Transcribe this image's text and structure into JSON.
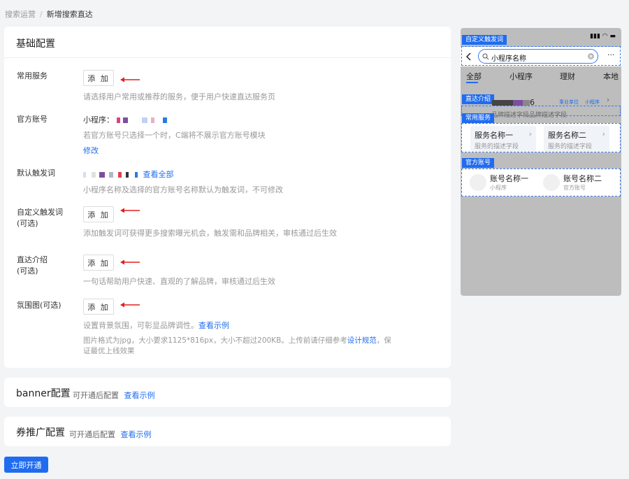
{
  "breadcrumb": {
    "parent": "搜索运营",
    "separator": "/",
    "current": "新增搜索直达"
  },
  "basic": {
    "title": "基础配置",
    "common_service": {
      "label": "常用服务",
      "button": "添 加",
      "hint": "请选择用户常用或推荐的服务，便于用户快速直达服务页"
    },
    "official_account": {
      "label": "官方账号",
      "value_prefix": "小程序：",
      "hint": "若官方账号只选择一个时，C端将不展示官方账号模块",
      "modify": "修改"
    },
    "default_trigger": {
      "label": "默认触发词",
      "view_all": "查看全部",
      "hint": "小程序名称及选择的官方账号名称默认为触发词，不可修改"
    },
    "custom_trigger": {
      "label": "自定义触发词",
      "label2": "(可选)",
      "button": "添 加",
      "hint": "添加触发词可获得更多搜索曝光机会，触发需和品牌相关，审核通过后生效"
    },
    "intro": {
      "label": "直达介绍",
      "label2": "(可选)",
      "button": "添 加",
      "hint": "一句话帮助用户快速、直观的了解品牌，审核通过后生效"
    },
    "atmosphere": {
      "label": "氛围图(可选)",
      "button": "添 加",
      "hint": "设置背景氛围，可彰显品牌调性。",
      "example": "查看示例",
      "req_line1_a": "图片格式为jpg，大小要求1125*816px，大小不超过200KB。上传前请仔细参考",
      "req_link": "设计规范",
      "req_line1_b": "，保",
      "req_line2": "证最优上线效果"
    }
  },
  "banner": {
    "title": "banner配置",
    "hint": "可开通后配置",
    "example": "查看示例"
  },
  "coupon": {
    "title": "券推广配置",
    "hint": "可开通后配置",
    "example": "查看示例"
  },
  "submit": "立即开通",
  "preview": {
    "status_icons": "▮▮▮ ◠ ▬",
    "tag_custom": "自定义触发词",
    "search_text": "小程序名称",
    "more": "···",
    "tabs": [
      "全部",
      "小程序",
      "理财",
      "本地"
    ],
    "tag_intro": "直达介绍",
    "intro_num": "6",
    "intro_badge1": "事业单位",
    "intro_badge2": "小程序",
    "intro_desc": "品牌描述字段品牌描述字段",
    "tag_service": "常用服务",
    "services": [
      {
        "name": "服务名称一",
        "desc": "服务的描述字段"
      },
      {
        "name": "服务名称二",
        "desc": "服务的描述字段"
      }
    ],
    "tag_account": "官方账号",
    "accounts": [
      {
        "name": "账号名称一",
        "type": "小程序"
      },
      {
        "name": "账号名称二",
        "type": "官方账号"
      }
    ]
  },
  "colors": {
    "primary": "#1f6cf0",
    "arrow": "#e02020",
    "phone_bg": "#bdbdbd"
  }
}
